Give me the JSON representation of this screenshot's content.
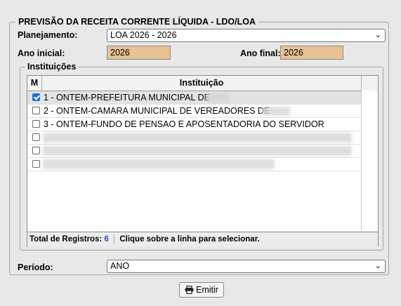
{
  "form": {
    "title": "PREVISÃO DA RECEITA CORRENTE LÍQUIDA - LDO/LOA",
    "planejamento_label": "Planejamento:",
    "planejamento_value": "LOA 2026 - 2026",
    "ano_inicial_label": "Ano inicial:",
    "ano_inicial_value": "2026",
    "ano_final_label": "Ano final:",
    "ano_final_value": "2026",
    "periodo_label": "Período:",
    "periodo_value": "ANO"
  },
  "instituicoes": {
    "legend": "Instituições",
    "columns": [
      "M",
      "Instituição"
    ],
    "rows": [
      {
        "text": "1 - ONTEM-PREFEITURA MUNICIPAL DE",
        "checked": true,
        "selected": true
      },
      {
        "text": "2 - ONTEM-CAMARA MUNICIPAL DE VEREADORES DE",
        "checked": false,
        "selected": false
      },
      {
        "text": "3 - ONTEM-FUNDO DE PENSAO E APOSENTADORIA DO SERVIDOR",
        "checked": false,
        "selected": false
      },
      {
        "text": "",
        "checked": false,
        "selected": false
      },
      {
        "text": "",
        "checked": false,
        "selected": false
      },
      {
        "text": "",
        "checked": false,
        "selected": false
      }
    ],
    "footer_total_label": "Total de Registros:",
    "footer_total_value": "6",
    "footer_hint": "Clique sobre a linha para selecionar."
  },
  "actions": {
    "emit_label": "Emitir"
  }
}
